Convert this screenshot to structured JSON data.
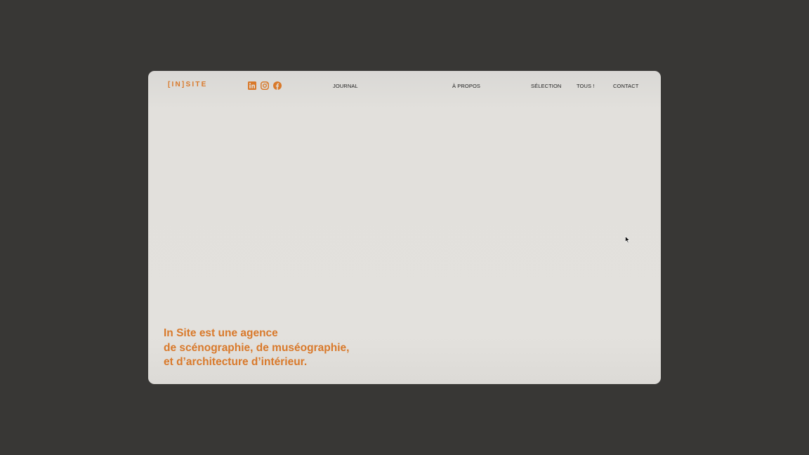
{
  "brand": {
    "logo_text": "[IN]SITE",
    "accent_color": "#d9792a",
    "frame_background": "#e2e0dc",
    "page_background": "#383735"
  },
  "socials": [
    {
      "name": "linkedin-icon"
    },
    {
      "name": "instagram-icon"
    },
    {
      "name": "facebook-icon"
    }
  ],
  "nav": {
    "journal": "JOURNAL",
    "a_propos": "À PROPOS",
    "selection": "SÉLECTION",
    "tous": "TOUS !",
    "contact": "CONTACT"
  },
  "hero": {
    "line1": "In Site est une agence",
    "line2": "de scénographie, de muséographie,",
    "line3": "et d’architecture d’intérieur."
  }
}
